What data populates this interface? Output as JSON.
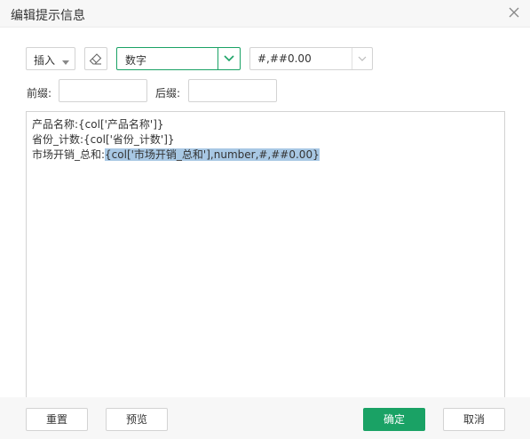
{
  "dialog": {
    "title": "编辑提示信息",
    "close_icon": "close-icon"
  },
  "toolbar": {
    "insert_label": "插入",
    "eraser_icon": "eraser-icon",
    "type_value": "数字",
    "format_value": "#,##0.00"
  },
  "fields": {
    "prefix_label": "前缀:",
    "prefix_value": "",
    "suffix_label": "后缀:",
    "suffix_value": ""
  },
  "editor": {
    "line1": "产品名称:{col['产品名称']}",
    "line2": "省份_计数:{col['省份_计数']}",
    "line3_plain": "市场开销_总和:",
    "line3_selected": "{col['市场开销_总和'],number,#,##0.00}"
  },
  "buttons": {
    "reset": "重置",
    "preview": "预览",
    "ok": "确定",
    "cancel": "取消"
  },
  "colors": {
    "accent": "#1aa265",
    "selection": "#a8c8e4"
  }
}
